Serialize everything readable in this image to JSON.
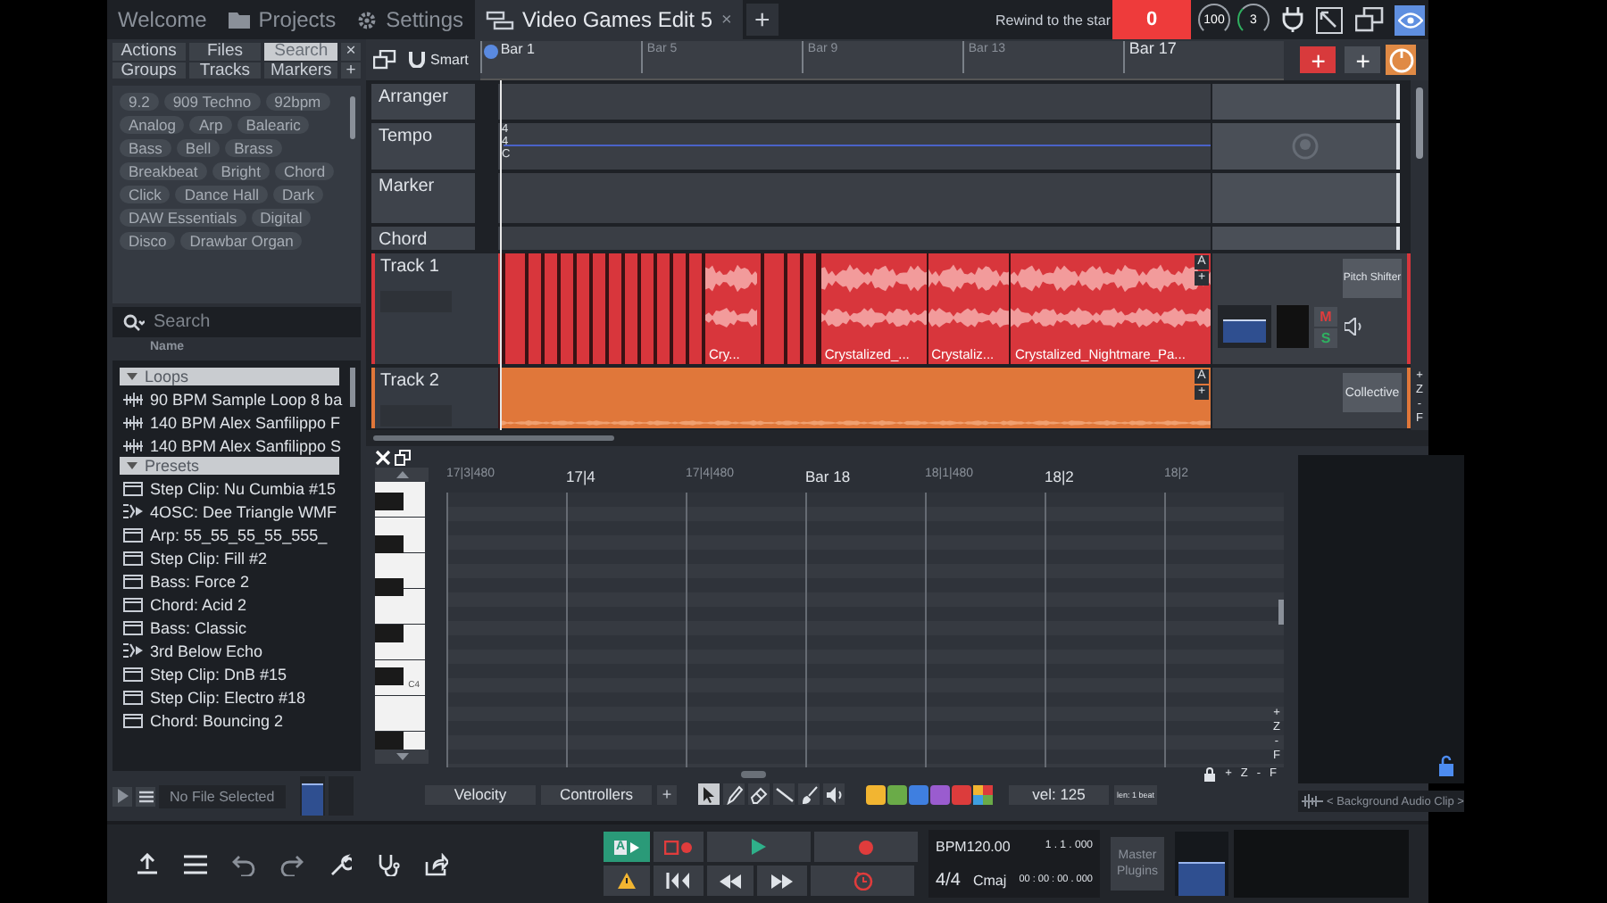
{
  "tabs": [
    {
      "label": "Welcome",
      "selected": false
    },
    {
      "label": "Projects",
      "selected": false
    },
    {
      "label": "Settings",
      "selected": false
    },
    {
      "label": "Video Games Edit 5",
      "selected": true,
      "close": "×"
    }
  ],
  "new_tab": "+",
  "status": {
    "tooltip": "Rewind to the star",
    "counter": "0",
    "dials": [
      "100",
      "3"
    ]
  },
  "browser": {
    "buttons": [
      {
        "label": "Actions",
        "selected": false
      },
      {
        "label": "Files",
        "selected": false
      },
      {
        "label": "Search",
        "selected": true
      },
      {
        "label": "×",
        "selected": false
      },
      {
        "label": "Groups",
        "selected": false
      },
      {
        "label": "Tracks",
        "selected": false
      },
      {
        "label": "Markers",
        "selected": false
      },
      {
        "label": "+",
        "selected": false
      }
    ],
    "tags": [
      "9.2",
      "909 Techno",
      "92bpm",
      "Analog",
      "Arp",
      "Balearic",
      "Bass",
      "Bell",
      "Brass",
      "Breakbeat",
      "Bright",
      "Chord",
      "Click",
      "Dance Hall",
      "Dark",
      "DAW Essentials",
      "Digital",
      "Disco",
      "Drawbar Organ"
    ],
    "search": {
      "placeholder": "Search"
    },
    "column": "Name",
    "groups": [
      {
        "label": "Loops",
        "expanded": true,
        "items": [
          {
            "label": "90 BPM Sample Loop 8 ba",
            "kind": "audio"
          },
          {
            "label": "140 BPM Alex Sanfilippo F",
            "kind": "audio"
          },
          {
            "label": "140 BPM Alex Sanfilippo S",
            "kind": "audio"
          }
        ]
      },
      {
        "label": "Presets",
        "expanded": true,
        "items": [
          {
            "label": "Step Clip: Nu Cumbia #15",
            "kind": "preset"
          },
          {
            "label": "4OSC: Dee Triangle WMF",
            "kind": "plugin"
          },
          {
            "label": "Arp: 55_55_55_55_555_",
            "kind": "preset"
          },
          {
            "label": "Step Clip: Fill #2",
            "kind": "preset"
          },
          {
            "label": "Bass: Force 2",
            "kind": "preset"
          },
          {
            "label": "Chord: Acid 2",
            "kind": "preset"
          },
          {
            "label": "Bass: Classic",
            "kind": "preset"
          },
          {
            "label": "3rd Below Echo",
            "kind": "plugin"
          },
          {
            "label": "Step Clip: DnB #15",
            "kind": "preset"
          },
          {
            "label": "Step Clip: Electro #18",
            "kind": "preset"
          },
          {
            "label": "Chord: Bouncing 2",
            "kind": "preset"
          }
        ]
      }
    ],
    "file_status": "No File Selected"
  },
  "arrange": {
    "snap": "Smart",
    "bars": [
      "Bar 1",
      "Bar 5",
      "Bar 9",
      "Bar 13",
      "Bar 17"
    ],
    "add_buttons": [
      "+",
      "+"
    ],
    "global_tracks": [
      {
        "name": "Arranger",
        "kind": "arranger"
      },
      {
        "name": "Tempo",
        "kind": "tempo"
      },
      {
        "name": "Marker",
        "kind": "marker"
      },
      {
        "name": "Chord",
        "kind": "chord"
      }
    ],
    "tempo_marks": [
      "4",
      "4",
      "C"
    ],
    "tracks": [
      {
        "name": "Track 1",
        "color": "#d8363c",
        "clips": [
          "Cry...",
          "Crystalized_...",
          "Crystaliz...",
          "Crystalized_Nightmare_Pa..."
        ],
        "clip_buttons": [
          "A",
          "+"
        ],
        "plugin": "Pitch Shifter",
        "mute": "M",
        "solo": "S"
      },
      {
        "name": "Track 2",
        "color": "#e0773a",
        "clip_buttons": [
          "A",
          "+"
        ],
        "plugin": "Collective"
      }
    ],
    "zoom": [
      "+",
      "Z",
      "-",
      "F"
    ]
  },
  "editor": {
    "ruler": [
      {
        "label": "17|3|480",
        "major": false
      },
      {
        "label": "17|4",
        "major": true
      },
      {
        "label": "17|4|480",
        "major": false
      },
      {
        "label": "Bar 18",
        "major": true
      },
      {
        "label": "18|1|480",
        "major": false
      },
      {
        "label": "18|2",
        "major": true
      },
      {
        "label": "18|2",
        "major": false
      }
    ],
    "key_label": "C4",
    "zoom_v": [
      "+",
      "Z",
      "-",
      "F"
    ],
    "lanes": [
      "Velocity",
      "Controllers"
    ],
    "add_lane": "+",
    "tools": [
      {
        "kind": "select",
        "selected": true
      },
      {
        "kind": "pencil",
        "selected": false
      },
      {
        "kind": "eraser",
        "selected": false
      },
      {
        "kind": "line",
        "selected": false
      },
      {
        "kind": "brush",
        "selected": false
      },
      {
        "kind": "speaker",
        "selected": false
      }
    ],
    "swatches": [
      {
        "kind": "solid",
        "color": "#f2b531"
      },
      {
        "kind": "solid",
        "color": "#6aab48"
      },
      {
        "kind": "solid",
        "color": "#3f7fe0"
      },
      {
        "kind": "solid",
        "color": "#9a5ccf"
      },
      {
        "kind": "solid",
        "color": "#dc3c3c"
      },
      {
        "kind": "multi"
      }
    ],
    "velocity": "vel: 125",
    "length": "len: 1 beat",
    "zoom_h": [
      "+",
      "Z",
      "-",
      "F"
    ],
    "background_clip": "< Background Audio Clip >"
  },
  "transport": {
    "loop_label": "A",
    "bpm": "BPM120.00",
    "position": "1 . 1 . 000",
    "signature": "4/4",
    "key": "Cmaj",
    "time": "00 : 00 : 00 . 000",
    "master": "Master Plugins"
  }
}
